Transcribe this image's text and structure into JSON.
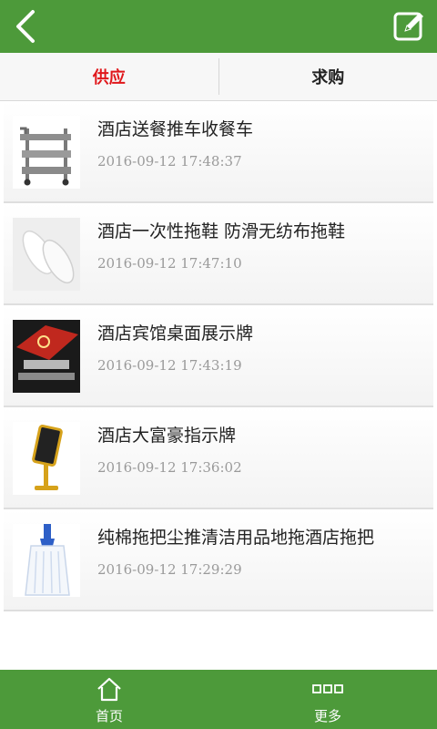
{
  "tabs": [
    {
      "label": "供应",
      "active": true
    },
    {
      "label": "求购",
      "active": false
    }
  ],
  "items": [
    {
      "title": "酒店送餐推车收餐车",
      "date": "2016-09-12 17:48:37",
      "thumb": "cart-icon"
    },
    {
      "title": "酒店一次性拖鞋 防滑无纺布拖鞋",
      "date": "2016-09-12 17:47:10",
      "thumb": "slippers-icon"
    },
    {
      "title": "酒店宾馆桌面展示牌",
      "date": "2016-09-12 17:43:19",
      "thumb": "desk-sign-icon"
    },
    {
      "title": "酒店大富豪指示牌",
      "date": "2016-09-12 17:36:02",
      "thumb": "sign-stand-icon"
    },
    {
      "title": "纯棉拖把尘推清洁用品地拖酒店拖把",
      "date": "2016-09-12 17:29:29",
      "thumb": "mop-icon"
    }
  ],
  "bottom_nav": [
    {
      "label": "首页",
      "icon": "home-icon"
    },
    {
      "label": "更多",
      "icon": "more-icon"
    }
  ],
  "colors": {
    "bar": "#4d9a3a",
    "active_tab": "#e0171b"
  }
}
